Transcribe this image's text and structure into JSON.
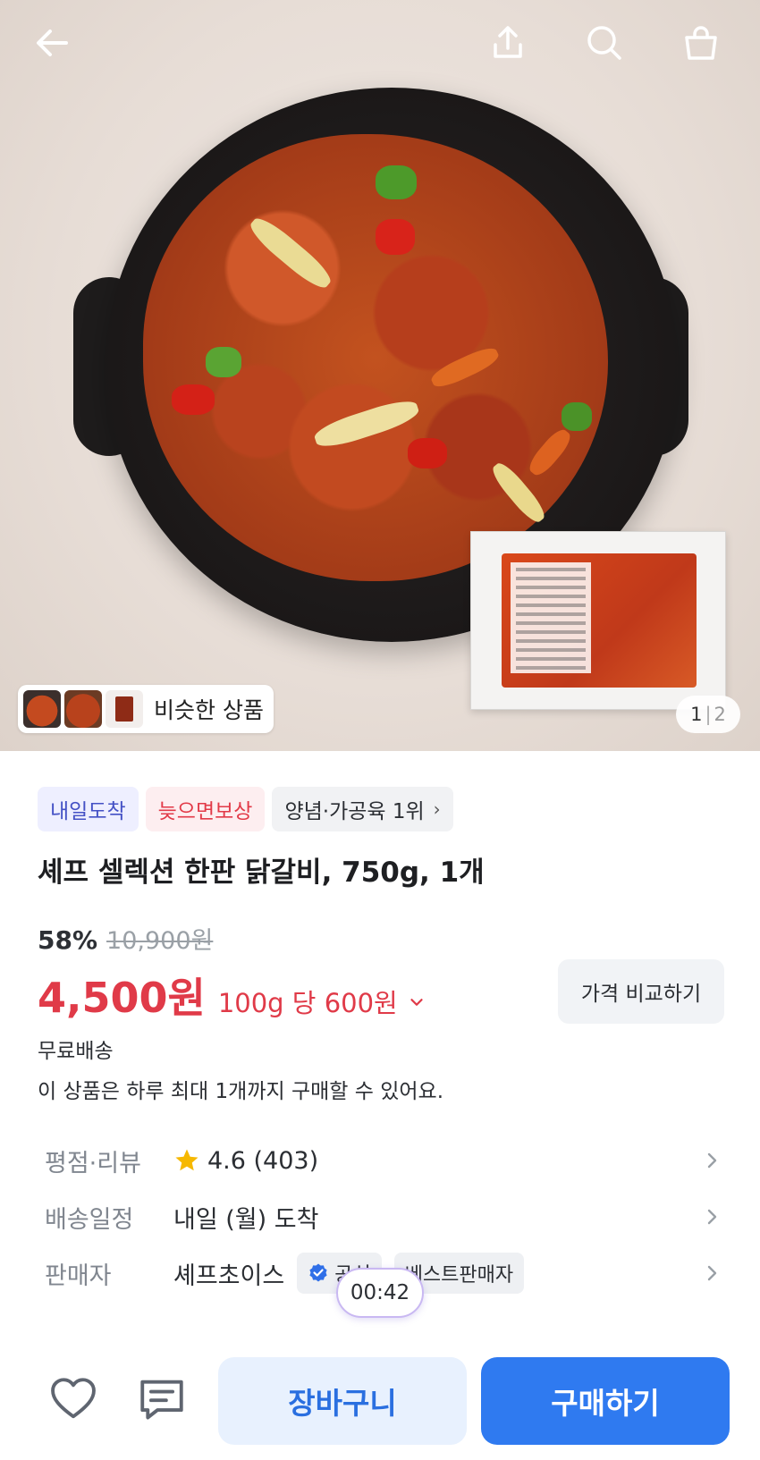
{
  "header": {
    "back_icon": "arrow-left-icon",
    "share_icon": "share-icon",
    "search_icon": "search-icon",
    "bag_icon": "shopping-bag-icon"
  },
  "gallery": {
    "similar_label": "비슷한 상품",
    "page_current": "1",
    "page_separator": "|",
    "page_total": "2"
  },
  "badges": {
    "arrival": "내일도착",
    "compensation": "늦으면보상",
    "ranking": "양념·가공육 1위"
  },
  "product": {
    "title": "셰프 셀렉션 한판 닭갈비, 750g, 1개",
    "discount": "58%",
    "original_price": "10,900원",
    "sale_price": "4,500원",
    "unit_price": "100g 당 600원",
    "compare_label": "가격 비교하기",
    "shipping": "무료배송",
    "purchase_limit": "이 상품은 하루 최대 1개까지 구매할 수 있어요."
  },
  "info": {
    "rating_key": "평점·리뷰",
    "rating_value": "4.6 (403)",
    "delivery_key": "배송일정",
    "delivery_value": "내일 (월) 도착",
    "seller_key": "판매자",
    "seller_value": "셰프초이스",
    "seller_badge1": "공식",
    "seller_badge2": "베스트판매자"
  },
  "timer": "00:42",
  "bottom": {
    "cart_label": "장바구니",
    "buy_label": "구매하기"
  },
  "colors": {
    "accent_blue": "#2f7af0",
    "price_red": "#e03a48",
    "badge_blue_text": "#4451c5",
    "star": "#f6b800"
  }
}
